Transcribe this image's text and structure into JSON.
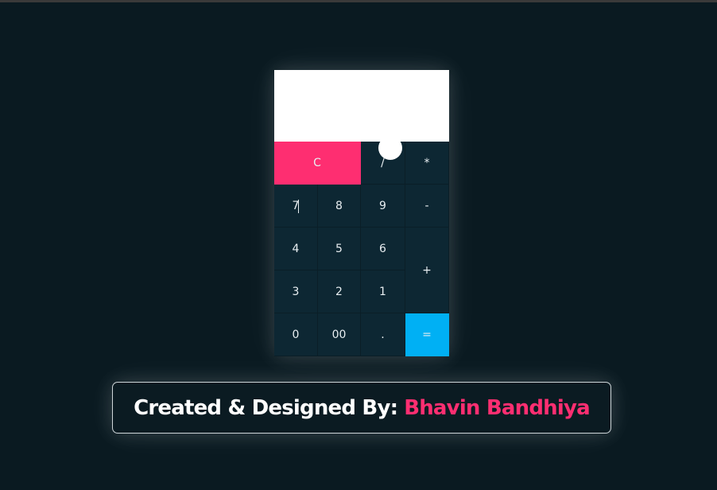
{
  "display": {
    "value": ""
  },
  "keys": {
    "clear": "C",
    "divide": "/",
    "multiply": "*",
    "seven": "7",
    "eight": "8",
    "nine": "9",
    "minus": "-",
    "four": "4",
    "five": "5",
    "six": "6",
    "plus": "+",
    "three": "3",
    "two": "2",
    "one": "1",
    "zero": "0",
    "double_zero": "00",
    "dot": ".",
    "equals": "="
  },
  "credit": {
    "label": "Created & Designed By:",
    "name": "Bhavin Bandhiya"
  },
  "colors": {
    "background": "#0a1a21",
    "key_background": "#0d2733",
    "clear_key": "#fe2e71",
    "equals_key": "#00b0f4",
    "author_name": "#fe2e71"
  }
}
